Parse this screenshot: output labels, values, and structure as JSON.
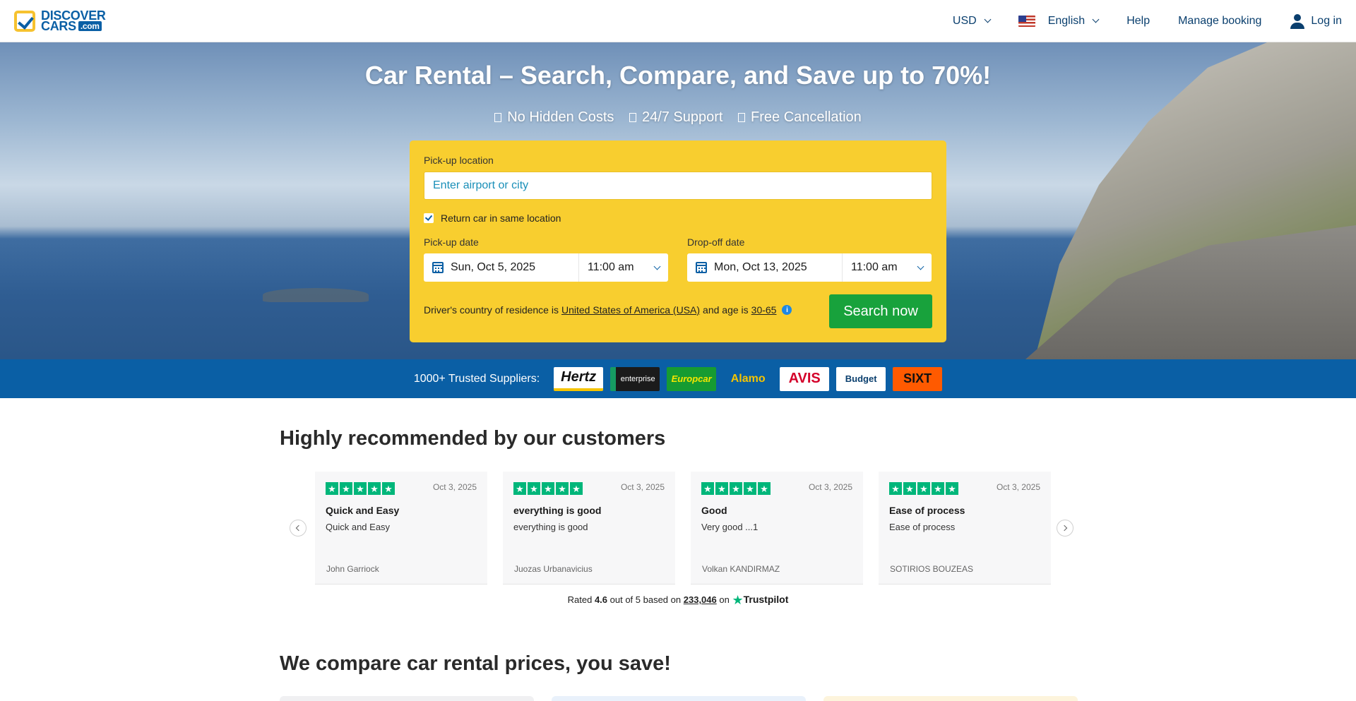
{
  "header": {
    "logo_line1": "DISCOVER",
    "logo_line2": "CARS",
    "logo_com": ".com",
    "currency": "USD",
    "language": "English",
    "help": "Help",
    "manage_booking": "Manage booking",
    "login": "Log in"
  },
  "hero": {
    "title": "Car Rental – Search, Compare, and Save up to 70%!",
    "benefits": [
      "No Hidden Costs",
      "24/7 Support",
      "Free Cancellation"
    ]
  },
  "search": {
    "pickup_label": "Pick-up location",
    "pickup_placeholder": "Enter airport or city",
    "same_location_label": "Return car in same location",
    "pickup_date_label": "Pick-up date",
    "pickup_date": "Sun, Oct 5, 2025",
    "pickup_time": "11:00 am",
    "dropoff_date_label": "Drop-off date",
    "dropoff_date": "Mon, Oct 13, 2025",
    "dropoff_time": "11:00 am",
    "residence_prefix": "Driver's country of residence is",
    "residence_country": "United States of America (USA)",
    "age_prefix": "and age is",
    "age_range": "30-65",
    "search_button": "Search now"
  },
  "suppliers": {
    "label": "1000+ Trusted Suppliers:",
    "items": [
      "Hertz",
      "enterprise",
      "Europcar",
      "Alamo",
      "AVIS",
      "Budget",
      "SIXT"
    ]
  },
  "reviews": {
    "title": "Highly recommended by our customers",
    "cards": [
      {
        "date": "Oct 3, 2025",
        "title": "Quick and Easy",
        "body": "Quick and Easy",
        "author": "John Garriock"
      },
      {
        "date": "Oct 3, 2025",
        "title": "everything is good",
        "body": "everything is good",
        "author": "Juozas Urbanavicius"
      },
      {
        "date": "Oct 3, 2025",
        "title": "Good",
        "body": "Very good ...1",
        "author": "Volkan KANDIRMAZ"
      },
      {
        "date": "Oct 3, 2025",
        "title": "Ease of process",
        "body": "Ease of process",
        "author": "SOTIRIOS BOUZEAS"
      }
    ],
    "rated_prefix": "Rated",
    "rating": "4.6",
    "rated_mid": "out of 5 based on",
    "review_count": "233,046",
    "rated_on": "on",
    "trustpilot": "Trustpilot"
  },
  "compare": {
    "title": "We compare car rental prices, you save!"
  },
  "colors": {
    "brand_blue": "#0a5fa5",
    "search_yellow": "#f8ce2f",
    "search_green": "#18a23c",
    "trustpilot_green": "#00b67a"
  }
}
